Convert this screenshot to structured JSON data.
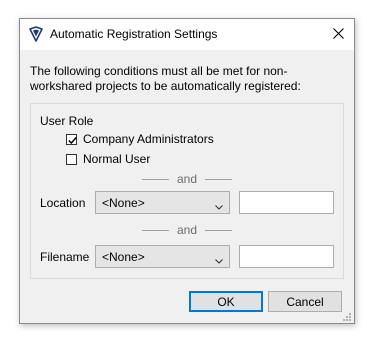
{
  "window": {
    "title": "Automatic Registration Settings",
    "icon": "app-shield-icon",
    "close_glyph": "✕"
  },
  "intro_text": "The following conditions must all be met for non-workshared projects to be automatically registered:",
  "user_role": {
    "label": "User Role",
    "options": [
      {
        "label": "Company Administrators",
        "checked": true
      },
      {
        "label": "Normal User",
        "checked": false
      }
    ]
  },
  "separators": {
    "and_1": "and",
    "and_2": "and"
  },
  "location": {
    "label": "Location",
    "selected": "<None>",
    "text_value": ""
  },
  "filename": {
    "label": "Filename",
    "selected": "<None>",
    "text_value": ""
  },
  "buttons": {
    "ok": "OK",
    "cancel": "Cancel"
  },
  "colors": {
    "accent": "#0078d7",
    "dialog_bg": "#f0f0f0",
    "icon": "#1f3b73"
  }
}
